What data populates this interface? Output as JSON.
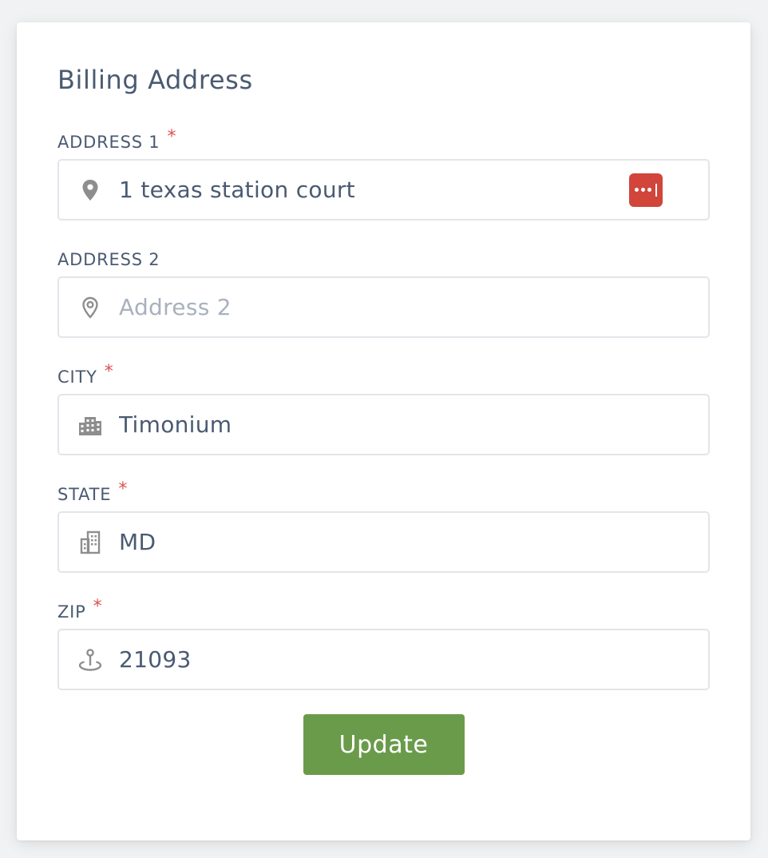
{
  "form": {
    "title": "Billing Address",
    "required_marker": "*",
    "fields": [
      {
        "label": "ADDRESS 1",
        "required": true,
        "value": "1 texas station court",
        "placeholder": "",
        "icon": "map-pin-solid-icon"
      },
      {
        "label": "ADDRESS 2",
        "required": false,
        "value": "",
        "placeholder": "Address 2",
        "icon": "map-pin-outline-icon"
      },
      {
        "label": "CITY",
        "required": true,
        "value": "Timonium",
        "placeholder": "",
        "icon": "city-buildings-icon"
      },
      {
        "label": "STATE",
        "required": true,
        "value": "MD",
        "placeholder": "",
        "icon": "office-building-icon"
      },
      {
        "label": "ZIP",
        "required": true,
        "value": "21093",
        "placeholder": "",
        "icon": "location-anchor-icon"
      }
    ],
    "submit_label": "Update"
  },
  "colors": {
    "label": "#4a5a72",
    "required": "#d9534f",
    "button": "#6a9b4a",
    "password_manager_badge": "#d1453b"
  }
}
